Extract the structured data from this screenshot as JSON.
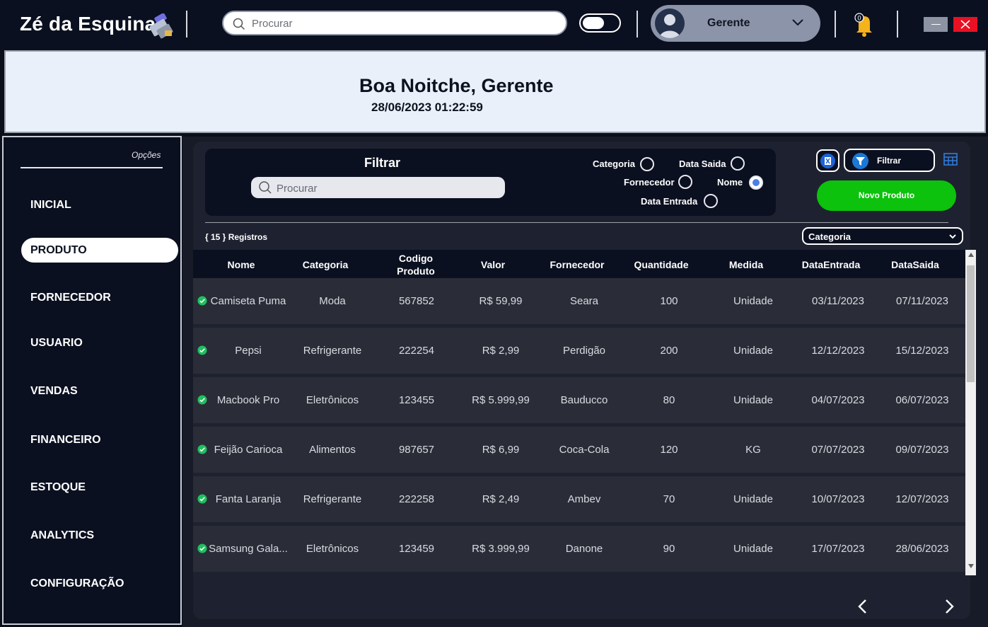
{
  "app": {
    "brand": "Zé da Esquina",
    "search_placeholder": "Procurar",
    "user_name": "Gerente",
    "notification_count": "0"
  },
  "greeting": {
    "title": "Boa Noitche, Gerente",
    "datetime": "28/06/2023 01:22:59"
  },
  "sidebar": {
    "header": "Opções",
    "items": [
      {
        "label": "INICIAL"
      },
      {
        "label": "PRODUTO"
      },
      {
        "label": "FORNECEDOR"
      },
      {
        "label": "USUARIO"
      },
      {
        "label": "VENDAS"
      },
      {
        "label": "FINANCEIRO"
      },
      {
        "label": "ESTOQUE"
      },
      {
        "label": "ANALYTICS"
      },
      {
        "label": "CONFIGURAÇÃO"
      }
    ]
  },
  "filter": {
    "title": "Filtrar",
    "search_placeholder": "Procurar",
    "options": {
      "categoria": "Categoria",
      "data_saida": "Data Saida",
      "fornecedor": "Fornecedor",
      "nome": "Nome",
      "data_entrada": "Data Entrada"
    },
    "selected": "Nome"
  },
  "toolbar": {
    "filtrar_label": "Filtrar",
    "novo_produto_label": "Novo Produto",
    "registros": "{ 15 } Registros",
    "category_select": "Categoria"
  },
  "table": {
    "headers": [
      "Nome",
      "Categoria",
      "Codigo\nProduto",
      "Valor",
      "Fornecedor",
      "Quantidade",
      "Medida",
      "DataEntrada",
      "DataSaida"
    ],
    "rows": [
      [
        "Camiseta Puma",
        "Moda",
        "567852",
        "R$ 59,99",
        "Seara",
        "100",
        "Unidade",
        "03/11/2023",
        "07/11/2023"
      ],
      [
        "Pepsi",
        "Refrigerante",
        "222254",
        "R$ 2,99",
        "Perdigão",
        "200",
        "Unidade",
        "12/12/2023",
        "15/12/2023"
      ],
      [
        "Macbook Pro",
        "Eletrônicos",
        "123455",
        "R$ 5.999,99",
        "Bauducco",
        "80",
        "Unidade",
        "04/07/2023",
        "06/07/2023"
      ],
      [
        "Feijão Carioca",
        "Alimentos",
        "987657",
        "R$ 6,99",
        "Coca-Cola",
        "120",
        "KG",
        "07/07/2023",
        "09/07/2023"
      ],
      [
        "Fanta Laranja",
        "Refrigerante",
        "222258",
        "R$ 2,49",
        "Ambev",
        "70",
        "Unidade",
        "10/07/2023",
        "12/07/2023"
      ],
      [
        "Samsung Gala...",
        "Eletrônicos",
        "123459",
        "R$ 3.999,99",
        "Danone",
        "90",
        "Unidade",
        "17/07/2023",
        "28/06/2023"
      ]
    ]
  },
  "colors": {
    "background": "#0b1020",
    "accent_green": "#0cc20c",
    "radio_selected": "#4a7fe8",
    "close": "#e81123"
  }
}
